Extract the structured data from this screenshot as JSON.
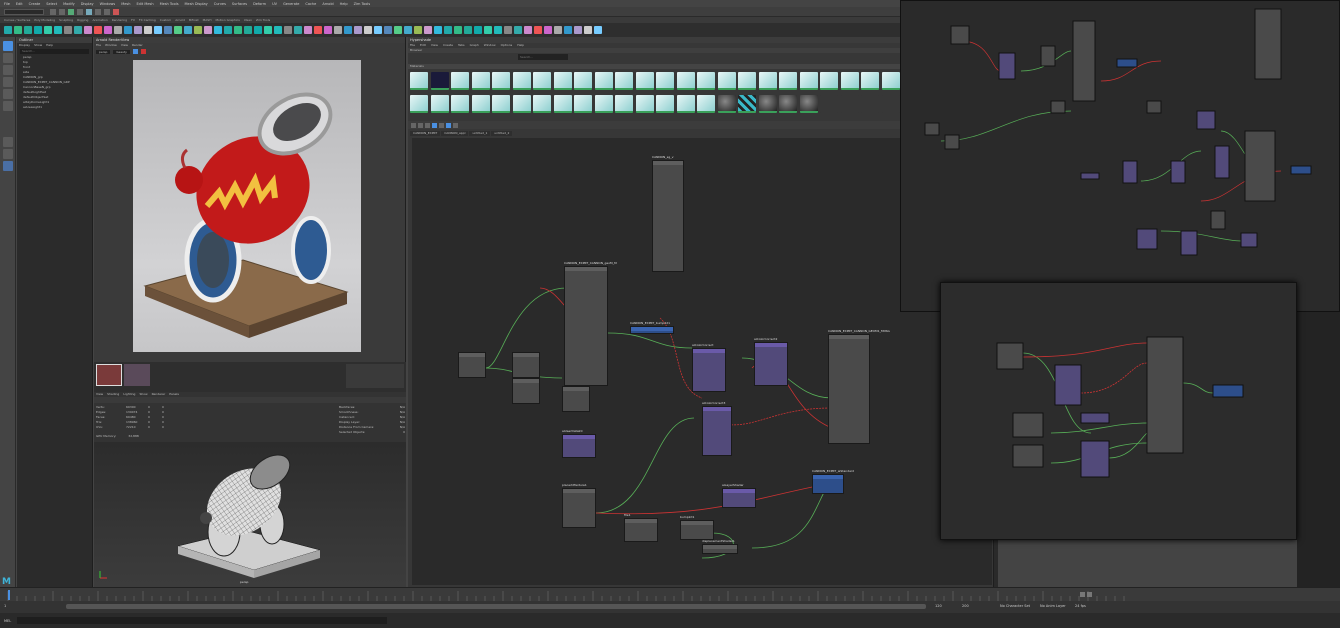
{
  "menu": [
    "File",
    "Edit",
    "Create",
    "Select",
    "Modify",
    "Display",
    "Windows",
    "Mesh",
    "Edit Mesh",
    "Mesh Tools",
    "Mesh Display",
    "Curves",
    "Surfaces",
    "Deform",
    "UV",
    "Generate",
    "Cache",
    "Arnold",
    "Help",
    "Zim Tools"
  ],
  "shelf_tabs": [
    "Curves / Surfaces",
    "Poly Modeling",
    "Sculpting",
    "Rigging",
    "Animation",
    "Rendering",
    "FX",
    "FX Caching",
    "Custom",
    "Arnold",
    "Bifrost",
    "MASH",
    "Motion Graphics",
    "XGen",
    "Zim Tools"
  ],
  "outliner": {
    "title": "Outliner",
    "menu": [
      "Display",
      "Show",
      "Help"
    ],
    "search_placeholder": "Search...",
    "items": [
      "persp",
      "top",
      "front",
      "side",
      "CANNON_grp",
      "CANNON_EXPRT_CANNON_GRP",
      "CannonBaseN_grp",
      "defaultLightSet",
      "defaultObjectSet",
      "aiSkyDomeLight1",
      "aiAreaLight1"
    ]
  },
  "render_view": {
    "title": "Arnold RenderView",
    "menu": [
      "File",
      "Window",
      "View",
      "Render"
    ],
    "camera": "persp",
    "aov": "beauty"
  },
  "stats": {
    "rows": [
      {
        "label": "Verts:",
        "a": "69300",
        "b": "0",
        "c": "0"
      },
      {
        "label": "Edges:",
        "a": "139074",
        "b": "0",
        "c": "0"
      },
      {
        "label": "Faces:",
        "a": "69480",
        "b": "0",
        "c": "0"
      },
      {
        "label": "Tris:",
        "a": "138960",
        "b": "0",
        "c": "0"
      },
      {
        "label": "UVs:",
        "a": "72210",
        "b": "0",
        "c": "0"
      }
    ],
    "side": [
      {
        "k": "Backfaces:",
        "v": "N/A"
      },
      {
        "k": "Smoothness:",
        "v": "N/A"
      },
      {
        "k": "Instanced:",
        "v": "N/A"
      },
      {
        "k": "Display Layer:",
        "v": "N/A"
      },
      {
        "k": "Distance From Camera:",
        "v": "N/A"
      },
      {
        "k": "Selected Objects:",
        "v": "0"
      }
    ],
    "gpu_label": "GPU Memory:",
    "gpu_value": "32,888"
  },
  "viewport": {
    "menu": [
      "View",
      "Shading",
      "Lighting",
      "Show",
      "Renderer",
      "Panels"
    ],
    "camera_label": "persp"
  },
  "hypershade": {
    "title": "Hypershade",
    "menu": [
      "File",
      "Edit",
      "View",
      "Create",
      "Tabs",
      "Graph",
      "Window",
      "Options",
      "Help"
    ],
    "browser_label": "Browser",
    "tabs": [
      "CANNON_EXPRT",
      "CANNON_appl",
      "untitled_1",
      "untitled_2"
    ],
    "search_placeholder": "Search..."
  },
  "nodes": [
    {
      "label": "CANNON_sg_v",
      "type": "g"
    },
    {
      "label": "CANNON_EXPRT_CANNON_geoM_M",
      "type": "g"
    },
    {
      "label": "CANNON_EXPRT_bump2d1",
      "type": "b"
    },
    {
      "label": "aiColorCorrect",
      "type": "p"
    },
    {
      "label": "aiColorCorrect2",
      "type": "p"
    },
    {
      "label": "aiColorCorrect3",
      "type": "p"
    },
    {
      "label": "CANNON_EXPRT_CANNON_GEOM1_MtlSG",
      "type": "g"
    },
    {
      "label": "CANNON_EXPRT_aiStandard",
      "type": "b"
    },
    {
      "label": "aiUserDataInt",
      "type": "p"
    },
    {
      "label": "place2dTexture1",
      "type": "g"
    },
    {
      "label": "file1",
      "type": "g"
    },
    {
      "label": "aiLayerShader",
      "type": "p"
    },
    {
      "label": "bump2d1",
      "type": "g"
    },
    {
      "label": "displacementShader1",
      "type": "g"
    }
  ],
  "timeline": {
    "start": "1",
    "end": "120",
    "range_start": "1",
    "range_end": "200",
    "fps": "24 fps",
    "char_set": "No Character Set",
    "anim_layer": "No Anim Layer"
  },
  "cmdline": {
    "lang": "MEL"
  },
  "colors": {
    "accent": "#4a90e2",
    "purple_node": "#524a7a",
    "blue_node": "#2d4e8a"
  }
}
